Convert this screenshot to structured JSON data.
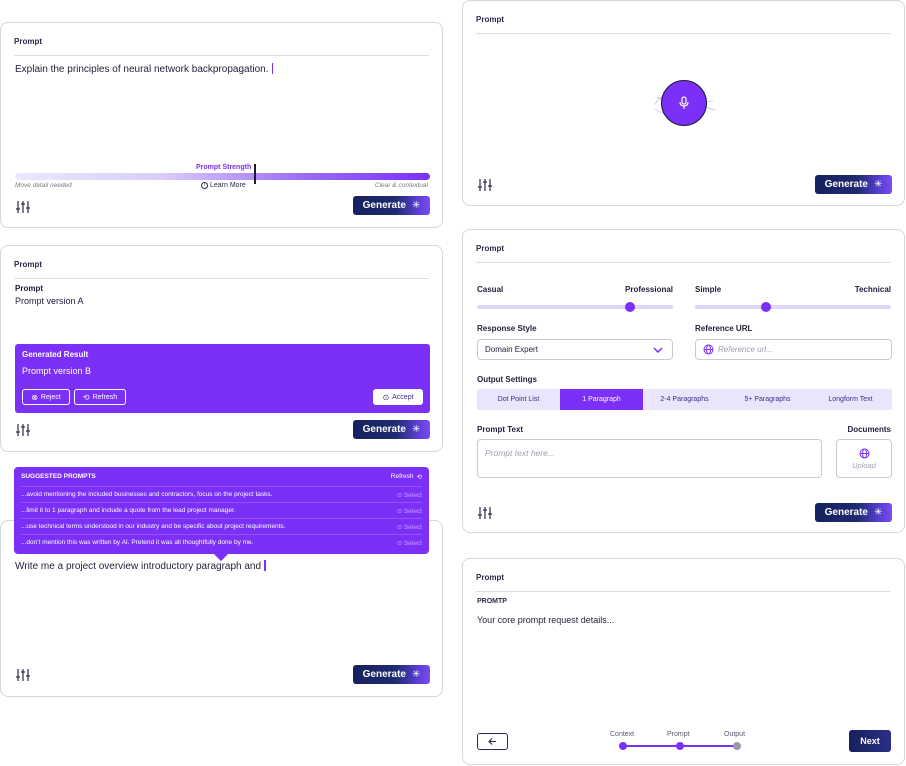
{
  "card1": {
    "header": "Prompt",
    "text": "Explain the principles of neural network backpropagation.",
    "strength_label": "Prompt Strength",
    "left_hint": "Move detail needed",
    "learn_more": "Learn More",
    "right_hint": "Clear & contextual",
    "strength_value": 0.58,
    "generate_label": "Generate"
  },
  "card2": {
    "header": "Prompt",
    "prompt_label": "Prompt",
    "prompt_value": "Prompt version A",
    "result_title": "Generated Result",
    "result_value": "Prompt version B",
    "reject_label": "Reject",
    "refresh_label": "Refresh",
    "accept_label": "Accept",
    "generate_label": "Generate"
  },
  "card3": {
    "suggested_title": "SUGGESTED PROMPTS",
    "refresh_label": "Refresh",
    "suggestions": [
      {
        "text": "...avoid mentioning the included businesses and contractors, focus on the project tasks.",
        "select": "Select"
      },
      {
        "text": "...limit it to 1 paragraph and include a quote from the lead project manager.",
        "select": "Select"
      },
      {
        "text": "...use technical terms understood in our industry and be specific about project requirements.",
        "select": "Select"
      },
      {
        "text": "...don't mention this was written by AI. Pretend it was all thoughtfully done by me.",
        "select": "Select"
      }
    ],
    "text": "Write me a project overview introductory paragraph and",
    "generate_label": "Generate"
  },
  "card4": {
    "header": "Prompt",
    "generate_label": "Generate"
  },
  "card5": {
    "header": "Prompt",
    "casual_label": "Casual",
    "professional_label": "Professional",
    "tone_value": 0.78,
    "simple_label": "Simple",
    "technical_label": "Technical",
    "complexity_value": 0.36,
    "response_style_label": "Response Style",
    "response_style_value": "Domain Expert",
    "reference_url_label": "Reference URL",
    "reference_url_placeholder": "Reference url...",
    "output_settings_label": "Output Settings",
    "output_options": [
      "Dot Point List",
      "1 Paragraph",
      "2-4 Paragraphs",
      "5+ Paragraphs",
      "Longform Text"
    ],
    "output_selected": "1 Paragraph",
    "prompt_text_label": "Prompt Text",
    "prompt_text_placeholder": "Prompt text here...",
    "documents_label": "Documents",
    "upload_label": "Upload",
    "generate_label": "Generate"
  },
  "card6": {
    "header": "Prompt",
    "sub_label": "PROMTP",
    "text": "Your core prompt request details...",
    "steps": [
      "Context",
      "Prompt",
      "Output"
    ],
    "next_label": "Next"
  },
  "colors": {
    "accent": "#7b2ff7",
    "navy": "#16215e",
    "track": "#ddd6f8"
  },
  "icons": [
    "sliders-icon",
    "sparkle-icon",
    "microphone-icon",
    "info-icon",
    "reject-icon",
    "refresh-icon",
    "accept-icon",
    "chevron-down-icon",
    "globe-icon",
    "arrow-left-icon"
  ]
}
